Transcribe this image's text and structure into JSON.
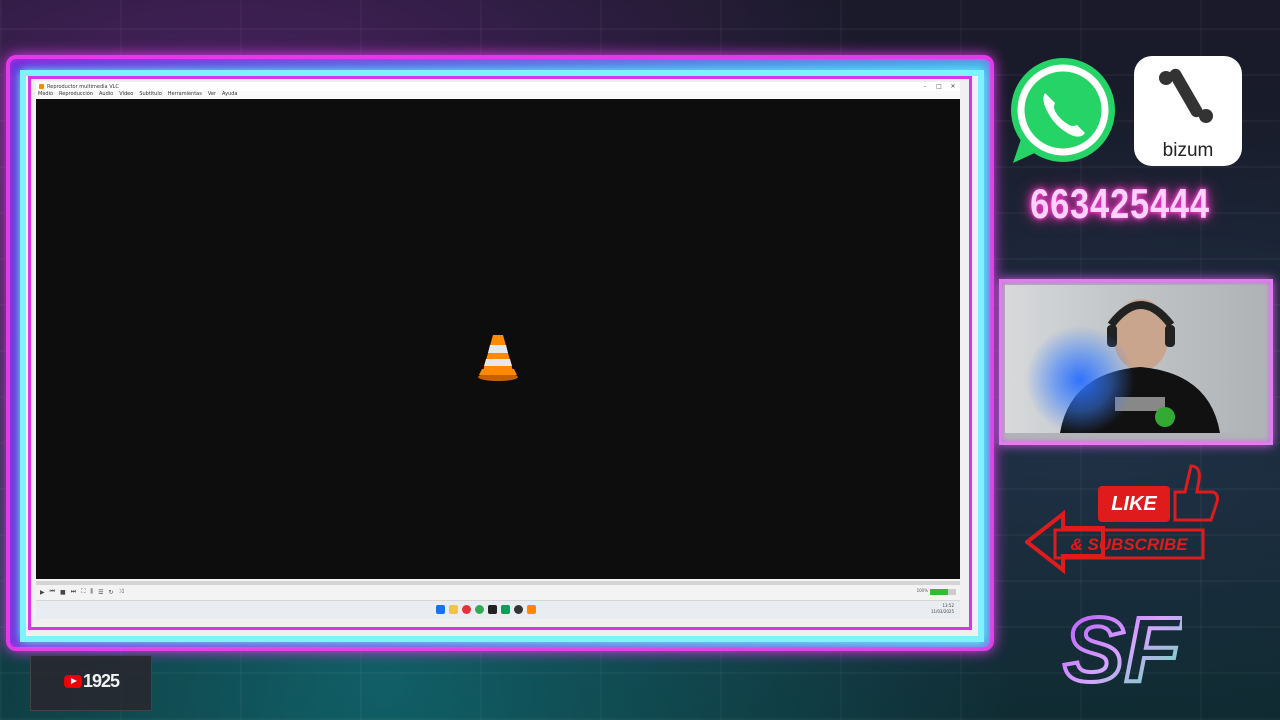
{
  "vlc": {
    "title": "Reproductor multimedia VLC",
    "menu": [
      "Medio",
      "Reproducción",
      "Audio",
      "Vídeo",
      "Subtítulo",
      "Herramientas",
      "Ver",
      "Ayuda"
    ],
    "window_buttons": {
      "minimize": "–",
      "maximize": "□",
      "close": "✕"
    },
    "controls": {
      "play": "▶",
      "prev": "⏮",
      "stop": "■",
      "next": "⏭",
      "fullscreen": "⛶",
      "ext": "⫼",
      "playlist": "☰",
      "loop": "↻",
      "random": "⤨"
    },
    "volume_pct": "100%",
    "accent": "#ff8800"
  },
  "taskbar": {
    "clock_time": "13:52",
    "clock_date": "11/03/2025"
  },
  "overlay": {
    "bizum_label": "bizum",
    "phone": "663425444",
    "like_label": "LIKE",
    "subscribe_label": "& SUBSCRIBE",
    "sf_label": "SF",
    "subscriber_count": "1925",
    "colors": {
      "neon_pink": "#e23ae8",
      "neon_cyan": "#7ef2ff",
      "whatsapp": "#25d366",
      "like_red": "#e01b1b"
    }
  }
}
